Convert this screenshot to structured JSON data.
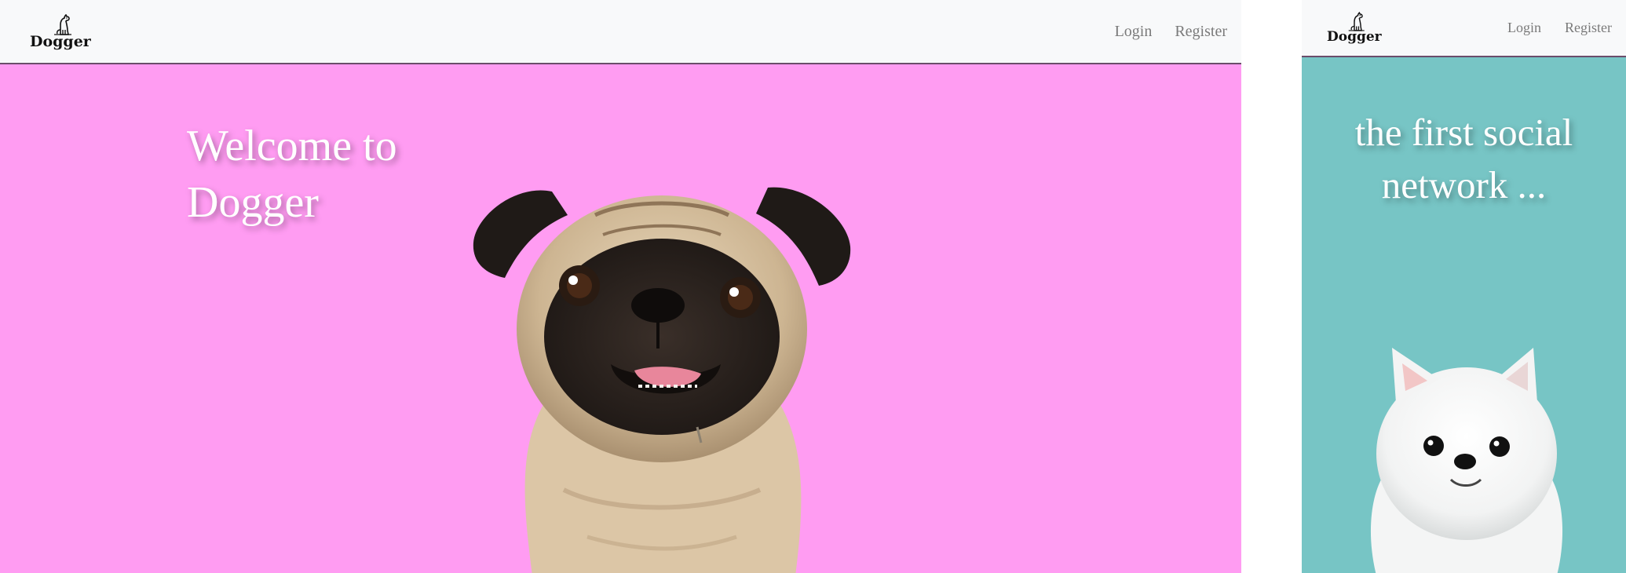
{
  "desktop": {
    "brand": {
      "name": "Dogger",
      "logo_icon": "sitting-dog-icon"
    },
    "nav": {
      "login": "Login",
      "register": "Register"
    },
    "hero": {
      "title": "Welcome to Dogger",
      "background": "#ff9cf2",
      "image": "pug-dog"
    }
  },
  "mobile": {
    "brand": {
      "name": "Dogger",
      "logo_icon": "sitting-dog-icon"
    },
    "nav": {
      "login": "Login",
      "register": "Register"
    },
    "hero": {
      "title": "the first social network ...",
      "background": "#77c5c5",
      "image": "white-pomeranian-dog"
    }
  }
}
